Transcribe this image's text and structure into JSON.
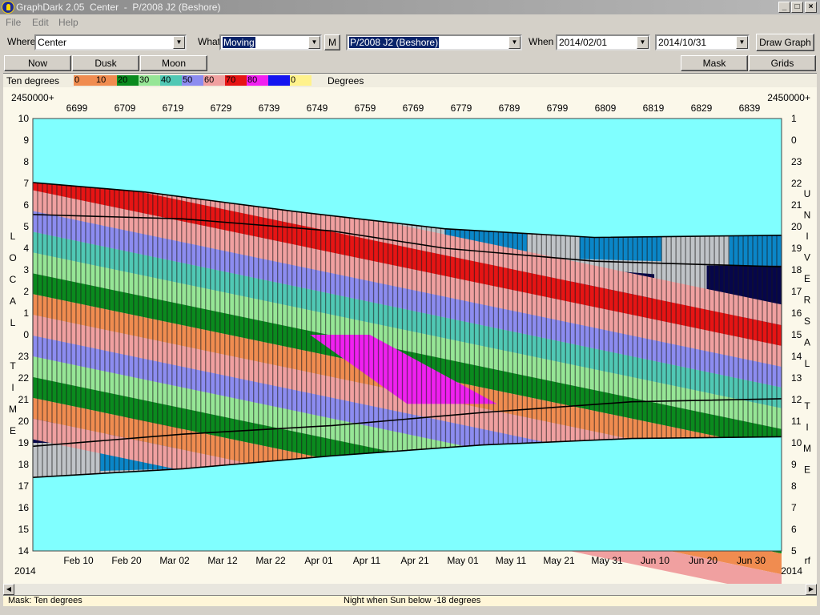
{
  "window": {
    "title": "GraphDark 2.05  Center  -  P/2008 J2 (Beshore)",
    "min": "_",
    "max": "□",
    "close": "×"
  },
  "menu": {
    "file": "File",
    "edit": "Edit",
    "help": "Help"
  },
  "controls": {
    "where_label": "Where",
    "where_value": "Center",
    "what_label": "What",
    "what_value": "Moving",
    "m_button": "M",
    "object_value": "P/2008 J2 (Beshore)",
    "when_label": "When",
    "start_date": "2014/02/01",
    "end_date": "2014/10/31",
    "draw_button": "Draw Graph"
  },
  "buttons": {
    "now": "Now",
    "dusk": "Dusk",
    "moon": "Moon",
    "mask": "Mask",
    "grids": "Grids"
  },
  "legend": {
    "title": "Ten degrees",
    "units": "Degrees",
    "entries": [
      {
        "label": "0",
        "color": "#f08c50"
      },
      {
        "label": "10",
        "color": "#f08c50"
      },
      {
        "label": "20",
        "color": "#0a8a1e"
      },
      {
        "label": "30",
        "color": "#96e696"
      },
      {
        "label": "40",
        "color": "#50c8b4"
      },
      {
        "label": "50",
        "color": "#8c8cf0"
      },
      {
        "label": "60",
        "color": "#f0a0a0"
      },
      {
        "label": "70",
        "color": "#e61414"
      },
      {
        "label": "80",
        "color": "#f020f0"
      },
      {
        "label": "",
        "color": "#1414f0"
      },
      {
        "label": "0",
        "color": "#fff28c"
      }
    ]
  },
  "chart_data": {
    "type": "heatmap",
    "top_axis_prefix_left": "2450000+",
    "top_axis_prefix_right": "2450000+",
    "top_ticks": [
      "6699",
      "6709",
      "6719",
      "6729",
      "6739",
      "6749",
      "6759",
      "6769",
      "6779",
      "6789",
      "6799",
      "6809",
      "6819",
      "6829",
      "6839"
    ],
    "bottom_ticks": [
      "Feb 10",
      "Feb 20",
      "Mar 02",
      "Mar 12",
      "Mar 22",
      "Apr 01",
      "Apr 11",
      "Apr 21",
      "May 01",
      "May 11",
      "May 21",
      "May 31",
      "Jun 10",
      "Jun 20",
      "Jun 30"
    ],
    "year_left": "2014",
    "year_right": "2014",
    "corner_right": "rf",
    "left_ticks": [
      "10",
      "9",
      "8",
      "7",
      "6",
      "5",
      "4",
      "3",
      "2",
      "1",
      "0",
      "23",
      "22",
      "21",
      "20",
      "19",
      "18",
      "17",
      "16",
      "15",
      "14"
    ],
    "right_ticks": [
      "1",
      "0",
      "23",
      "22",
      "21",
      "20",
      "19",
      "18",
      "17",
      "16",
      "15",
      "14",
      "13",
      "12",
      "11",
      "10",
      "9",
      "8",
      "7",
      "6",
      "5"
    ],
    "left_label": [
      "L",
      "O",
      "C",
      "A",
      "L",
      "",
      "T",
      "I",
      "M",
      "E"
    ],
    "right_label": [
      "U",
      "N",
      "I",
      "V",
      "E",
      "R",
      "S",
      "A",
      "L",
      "",
      "T",
      "I",
      "M",
      "E"
    ],
    "colors": {
      "day_sky": "#80ffff",
      "below_horizon": "#c0c4c8",
      "dark_navy": "#06064a",
      "twilight_blue": "#0a86c8"
    }
  },
  "status": {
    "mask": "Mask:  Ten degrees",
    "night": "Night when Sun below -18 degrees"
  }
}
